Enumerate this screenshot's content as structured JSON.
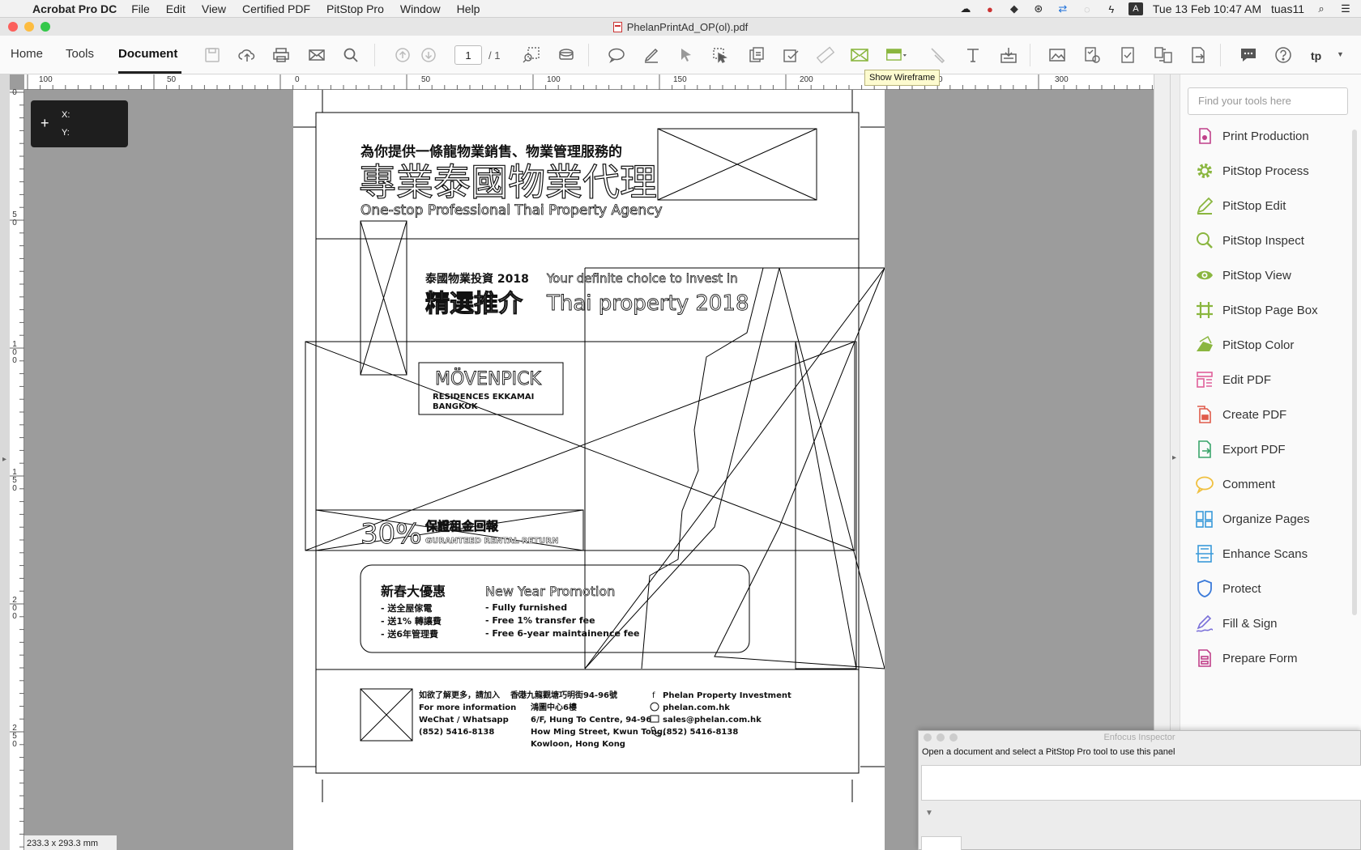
{
  "menubar": {
    "app_name": "Acrobat Pro DC",
    "items": [
      "File",
      "Edit",
      "View",
      "Certified PDF",
      "PitStop Pro",
      "Window",
      "Help"
    ],
    "datetime": "Tue 13 Feb  10:47 AM",
    "user": "tuas11"
  },
  "window": {
    "title": "PhelanPrintAd_OP(ol).pdf"
  },
  "toolbar": {
    "tabs": [
      "Home",
      "Tools",
      "Document"
    ],
    "active_tab": "Document",
    "page_current": "1",
    "page_total": "/ 1",
    "tooltip": "Show Wireframe",
    "user_initials": "tp"
  },
  "ruler": {
    "h_labels": [
      "100",
      "50",
      "0",
      "50",
      "100",
      "150",
      "200",
      "0",
      "300"
    ],
    "v_labels": [
      "0",
      "50",
      "100",
      "150",
      "200",
      "250"
    ]
  },
  "coords": {
    "x_label": "X:",
    "y_label": "Y:"
  },
  "status": {
    "page_size": "233.3 x 293.3 mm"
  },
  "document": {
    "headline_small": "為你提供一條龍物業銷售、物業管理服務的",
    "headline_big": "專業泰國物業代理",
    "headline_en": "One-stop Professional Thai Property Agency",
    "invest_cn_small": "泰國物業投資 2018",
    "invest_cn_big": "精選推介",
    "invest_en_small": "Your definite choice to invest in",
    "invest_en_big": "Thai property 2018",
    "logo_main": "MÖVENPICK",
    "logo_line1": "RESIDENCES EKKAMAI",
    "logo_line2": "BANGKOK",
    "percent": "30%",
    "return_cn": "保證租金回報",
    "return_en": "GURANTEED RENTAL RETURN",
    "promo_cn_title": "新春大優惠",
    "promo_cn_items": [
      "- 送全屋傢電",
      "- 送1% 轉讓費",
      "- 送6年管理費"
    ],
    "promo_en_title": "New Year Promotion",
    "promo_en_items": [
      "- Fully furnished",
      "- Free 1% transfer fee",
      "- Free 6-year maintainence fee"
    ],
    "contact_cn": "如欲了解更多，請加入",
    "contact_lines": [
      "For more information",
      "WeChat / Whatsapp",
      "(852) 5416-8138"
    ],
    "addr_cn1": "香港九龍觀塘巧明街94-96號",
    "addr_cn2": "鴻圖中心6樓",
    "addr_en": [
      "6/F, Hung To Centre, 94-96",
      "How Ming Street, Kwun Tong,",
      "Kowloon, Hong Kong"
    ],
    "company": "Phelan Property Investment",
    "website": "phelan.com.hk",
    "email": "sales@phelan.com.hk",
    "phone": "(852) 5416-8138"
  },
  "tools_pane": {
    "search_placeholder": "Find your tools here",
    "items": [
      {
        "label": "Print Production",
        "icon": "print-production-icon",
        "color": "#c0408a"
      },
      {
        "label": "PitStop Process",
        "icon": "gear-icon",
        "color": "#8ab63f"
      },
      {
        "label": "PitStop Edit",
        "icon": "pencil-icon",
        "color": "#8ab63f"
      },
      {
        "label": "PitStop Inspect",
        "icon": "magnifier-icon",
        "color": "#8ab63f"
      },
      {
        "label": "PitStop View",
        "icon": "eye-icon",
        "color": "#8ab63f"
      },
      {
        "label": "PitStop Page Box",
        "icon": "crop-icon",
        "color": "#8ab63f"
      },
      {
        "label": "PitStop Color",
        "icon": "color-icon",
        "color": "#8ab63f"
      },
      {
        "label": "Edit PDF",
        "icon": "edit-pdf-icon",
        "color": "#e0609a"
      },
      {
        "label": "Create PDF",
        "icon": "create-pdf-icon",
        "color": "#e05a4a"
      },
      {
        "label": "Export PDF",
        "icon": "export-pdf-icon",
        "color": "#3aa56b"
      },
      {
        "label": "Comment",
        "icon": "comment-icon",
        "color": "#f0c040"
      },
      {
        "label": "Organize Pages",
        "icon": "organize-pages-icon",
        "color": "#3a9ad9"
      },
      {
        "label": "Enhance Scans",
        "icon": "scan-icon",
        "color": "#3a9ad9"
      },
      {
        "label": "Protect",
        "icon": "shield-icon",
        "color": "#3a7ad9"
      },
      {
        "label": "Fill & Sign",
        "icon": "sign-icon",
        "color": "#7a70d9"
      },
      {
        "label": "Prepare Form",
        "icon": "form-icon",
        "color": "#c0408a"
      }
    ]
  },
  "inspector": {
    "title": "Enfocus Inspector",
    "message": "Open a document and select a PitStop Pro tool to use this panel"
  },
  "colors": {
    "accent": "#1473e6",
    "workspace": "#9c9c9c",
    "tool_green": "#8ab63f"
  }
}
